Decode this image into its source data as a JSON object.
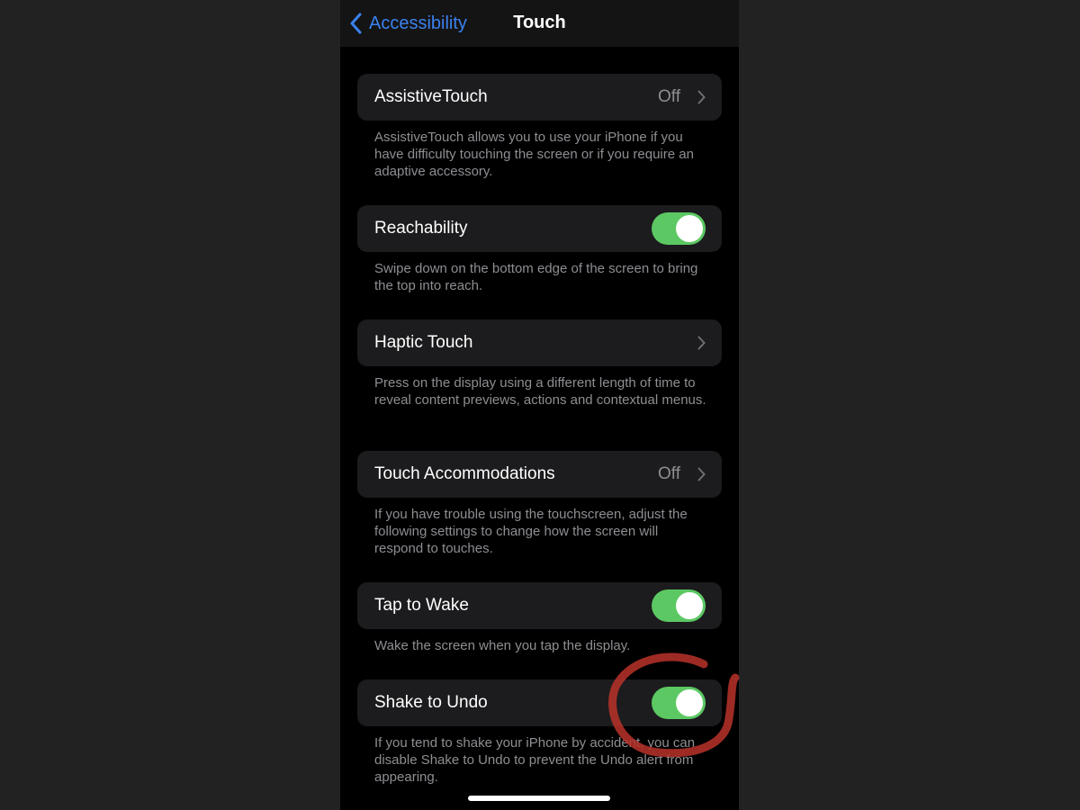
{
  "navbar": {
    "back_label": "Accessibility",
    "title": "Touch"
  },
  "settings": [
    {
      "label": "AssistiveTouch",
      "value": "Off",
      "control": "disclosure",
      "footer": "AssistiveTouch allows you to use your iPhone if you have difficulty touching the screen or if you require an adaptive accessory."
    },
    {
      "label": "Reachability",
      "control": "toggle",
      "on": true,
      "footer": "Swipe down on the bottom edge of the screen to bring the top into reach."
    },
    {
      "label": "Haptic Touch",
      "control": "disclosure",
      "footer": "Press on the display using a different length of time to reveal content previews, actions and contextual menus."
    },
    {
      "label": "Touch Accommodations",
      "value": "Off",
      "control": "disclosure",
      "footer": "If you have trouble using the touchscreen, adjust the following settings to change how the screen will respond to touches."
    },
    {
      "label": "Tap to Wake",
      "control": "toggle",
      "on": true,
      "footer": "Wake the screen when you tap the display."
    },
    {
      "label": "Shake to Undo",
      "control": "toggle",
      "on": true,
      "footer": "If you tend to shake your iPhone by accident, you can disable Shake to Undo to prevent the Undo alert from appearing."
    }
  ],
  "colors": {
    "accent": "#3b82f0",
    "toggle_on": "#5cc863",
    "annotation": "#c0392b"
  }
}
